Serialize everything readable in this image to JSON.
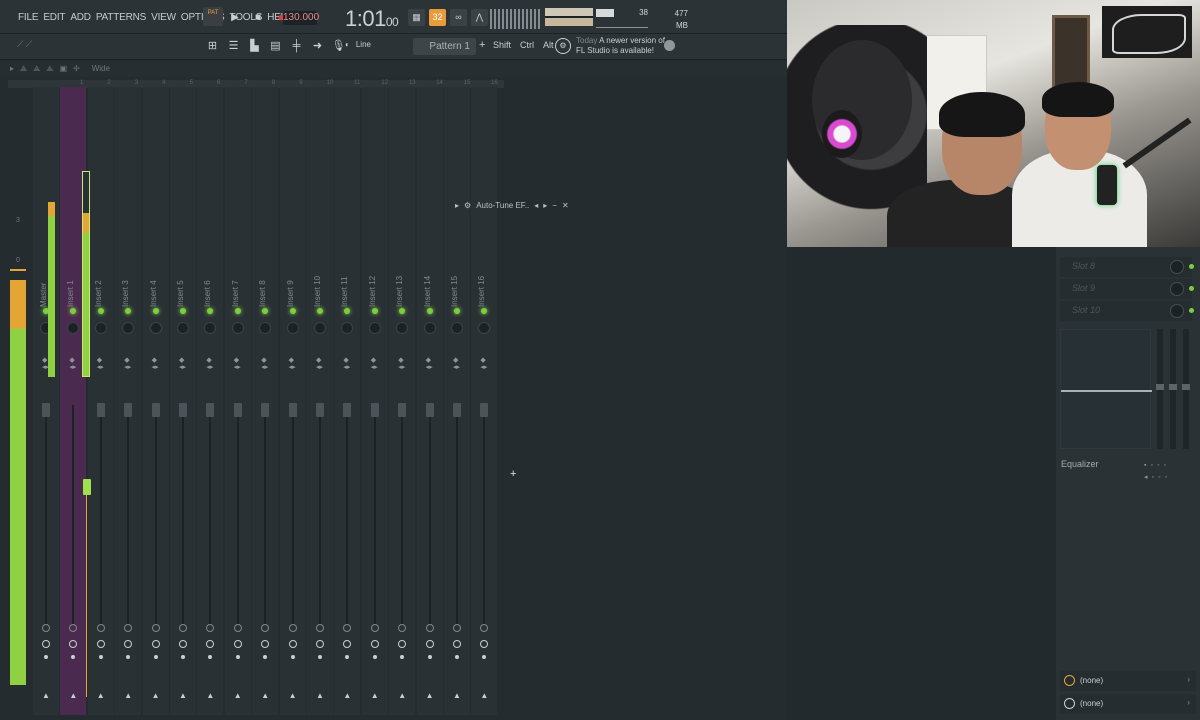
{
  "menu": [
    "FILE",
    "EDIT",
    "ADD",
    "PATTERNS",
    "VIEW",
    "OPTIONS",
    "TOOLS",
    "HELP"
  ],
  "pattern_mode_badge": "PAT",
  "tempo": "130.000",
  "time": {
    "main": "1:01",
    "sub": "00"
  },
  "toolbar_icon_active": "32",
  "cpu": "38",
  "memory": "477 MB",
  "memory_sub": "0",
  "snap": "Line",
  "pattern": "Pattern 1",
  "mods": [
    "Shift",
    "Ctrl",
    "Alt"
  ],
  "news": {
    "today": "Today",
    "line1": "A newer version of",
    "line2": "FL Studio is available!"
  },
  "mixer": {
    "view": "Wide",
    "ruler": [
      "1",
      "2",
      "3",
      "4",
      "5",
      "6",
      "7",
      "8",
      "9",
      "10",
      "11",
      "12",
      "13",
      "14",
      "15",
      "16"
    ],
    "scale": [
      "3",
      "0"
    ],
    "tracks": [
      "Master",
      "Insert 1",
      "Insert 2",
      "Insert 3",
      "Insert 4",
      "Insert 5",
      "Insert 6",
      "Insert 7",
      "Insert 8",
      "Insert 9",
      "Insert 10",
      "Insert 11",
      "Insert 12",
      "Insert 13",
      "Insert 14",
      "Insert 15",
      "Insert 16"
    ]
  },
  "plugin_window": {
    "title": "Auto-Tune EF.."
  },
  "right_panel": {
    "slots": [
      "Slot 8",
      "Slot 9",
      "Slot 10"
    ],
    "eq_label": "Equalizer",
    "routing": [
      "(none)",
      "(none)"
    ]
  }
}
